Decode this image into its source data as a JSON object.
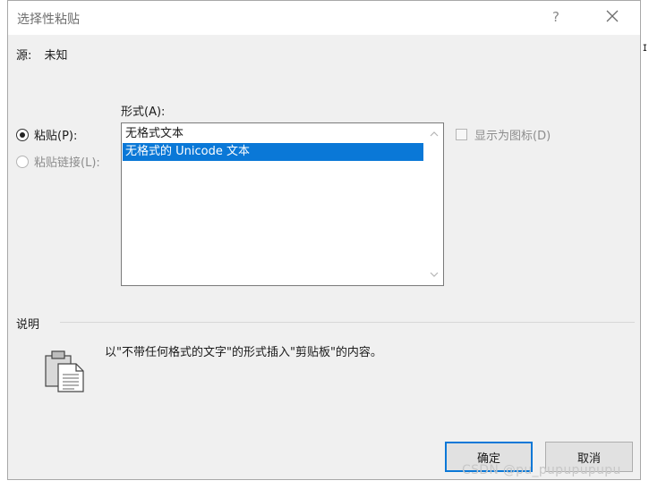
{
  "dialog": {
    "title": "选择性粘贴",
    "help": "?",
    "source_label": "源:",
    "source_value": "未知",
    "as_label": "形式(A):",
    "radio_paste": "粘贴(P):",
    "radio_paste_link": "粘贴链接(L):",
    "list_items": [
      "无格式文本",
      "无格式的 Unicode 文本"
    ],
    "selected_index": 1,
    "display_as_icon": "显示为图标(D)",
    "result_label": "说明",
    "result_text": "以\"不带任何格式的文字\"的形式插入\"剪贴板\"的内容。",
    "ok_label": "确定",
    "cancel_label": "取消"
  },
  "icons": [
    "close-icon",
    "scroll-up-arrow-icon",
    "scroll-down-arrow-icon",
    "clipboard-icon"
  ],
  "colors": {
    "selection": "#0a78d7",
    "dialog_bg": "#f0f0f0"
  },
  "watermark": "CSDN @pu_pupupupupu"
}
